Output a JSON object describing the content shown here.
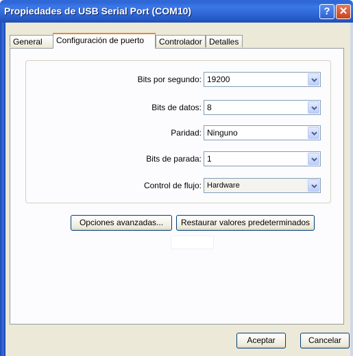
{
  "window": {
    "title": "Propiedades de USB Serial Port (COM10)",
    "help_glyph": "?",
    "close_glyph": "✕"
  },
  "tabs": [
    {
      "label": "General",
      "active": false
    },
    {
      "label": "Configuración de puerto",
      "active": true
    },
    {
      "label": "Controlador",
      "active": false
    },
    {
      "label": "Detalles",
      "active": false
    }
  ],
  "settings": [
    {
      "label": "Bits por segundo:",
      "value": "19200"
    },
    {
      "label": "Bits de datos:",
      "value": "8"
    },
    {
      "label": "Paridad:",
      "value": "Ninguno"
    },
    {
      "label": "Bits de parada:",
      "value": "1"
    },
    {
      "label": "Control de flujo:",
      "value": "Hardware"
    }
  ],
  "buttons": {
    "advanced": "Opciones avanzadas...",
    "restore": "Restaurar valores predeterminados",
    "ok": "Aceptar",
    "cancel": "Cancelar"
  },
  "colors": {
    "titlebar": "#2f66d6",
    "client": "#ece9d8",
    "active_tab_accent": "#e68b2c"
  },
  "icons": {
    "combo_arrow": "chevron-down-icon",
    "help": "help-icon",
    "close": "close-icon"
  }
}
